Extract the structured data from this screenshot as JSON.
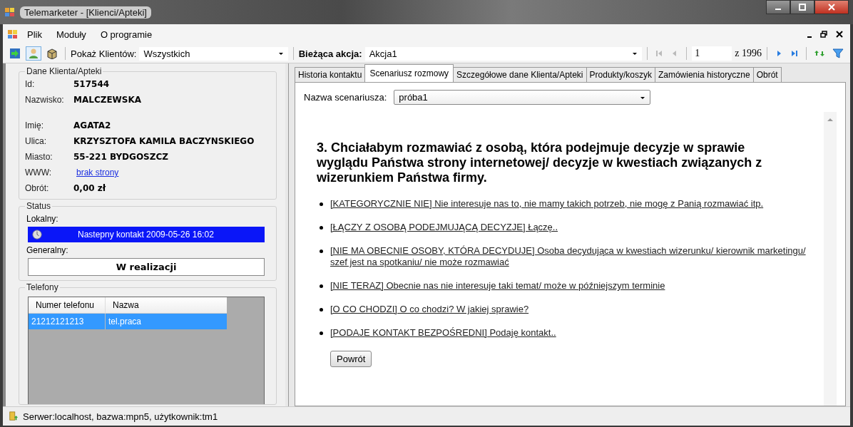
{
  "window": {
    "title": "Telemarketer - [Klienci/Apteki]"
  },
  "menu": [
    "Plik",
    "Moduły",
    "O programie"
  ],
  "toolbar": {
    "show_label": "Pokaż Klientów:",
    "show_value": "Wszystkich",
    "action_label": "Bieżąca akcja:",
    "action_value": "Akcja1",
    "page": "1",
    "page_total": "z 1996"
  },
  "client": {
    "title": "Dane Klienta/Apteki",
    "fields": [
      {
        "label": "Id:",
        "value": "517544",
        "kind": "text"
      },
      {
        "label": "Nazwisko:",
        "value": "MALCZEWSKA",
        "kind": "text"
      },
      {
        "label": "Imię:",
        "value": "AGATA2",
        "kind": "text"
      },
      {
        "label": "Ulica:",
        "value": "KRZYSZTOFA KAMILA BACZYNSKIEGO",
        "kind": "text"
      },
      {
        "label": "Miasto:",
        "value": "55-221 BYDGOSZCZ",
        "kind": "text"
      },
      {
        "label": "WWW:",
        "value": "brak strony",
        "kind": "link"
      },
      {
        "label": "Obrót:",
        "value": "0,00 zł",
        "kind": "text"
      }
    ]
  },
  "status": {
    "title": "Status",
    "local_label": "Lokalny:",
    "local_value": "Nastepny kontakt 2009-05-26 16:02",
    "general_label": "Generalny:",
    "general_value": "W realizacji"
  },
  "phones": {
    "title": "Telefony",
    "columns": [
      "Numer telefonu",
      "Nazwa"
    ],
    "rows": [
      {
        "cells": [
          "21212121213",
          "tel.praca"
        ],
        "selected": true
      }
    ]
  },
  "tabs": [
    {
      "label": "Historia kontaktu",
      "selected": false
    },
    {
      "label": "Scenariusz rozmowy",
      "selected": true
    },
    {
      "label": "Szczegółowe dane Klienta/Apteki",
      "selected": false
    },
    {
      "label": "Produkty/koszyk",
      "selected": false
    },
    {
      "label": "Zamówienia historyczne",
      "selected": false
    },
    {
      "label": "Obrót",
      "selected": false
    }
  ],
  "scenario": {
    "label": "Nazwa scenariusza:",
    "value": "próba1",
    "question": "3. Chciałabym rozmawiać z osobą, która podejmuje decyzje w sprawie wyglądu Państwa strony internetowej/ decyzje w kwestiach związanych z wizerunkiem Państwa firmy.",
    "options": [
      "[KATEGORYCZNIE NIE] Nie interesuje nas to, nie mamy takich potrzeb, nie mogę z Panią rozmawiać itp.",
      "[ŁĄCZY Z OSOBĄ PODEJMUJĄCĄ DECYZJE] Łączę..",
      "[NIE MA OBECNIE OSOBY, KTÓRA DECYDUJE] Osoba decydująca w kwestiach wizerunku/ kierownik marketingu/ szef jest na spotkaniu/ nie może rozmawiać",
      "[NIE TERAZ] Obecnie nas nie interesuje taki temat/ może w późniejszym terminie",
      "[O CO CHODZI] O co chodzi? W jakiej sprawie?",
      "[PODAJE KONTAKT BEZPOŚREDNI] Podaję kontakt.."
    ],
    "back": "Powrót"
  },
  "status_bar": "Serwer:localhost, bazwa:mpn5, użytkownik:tm1"
}
